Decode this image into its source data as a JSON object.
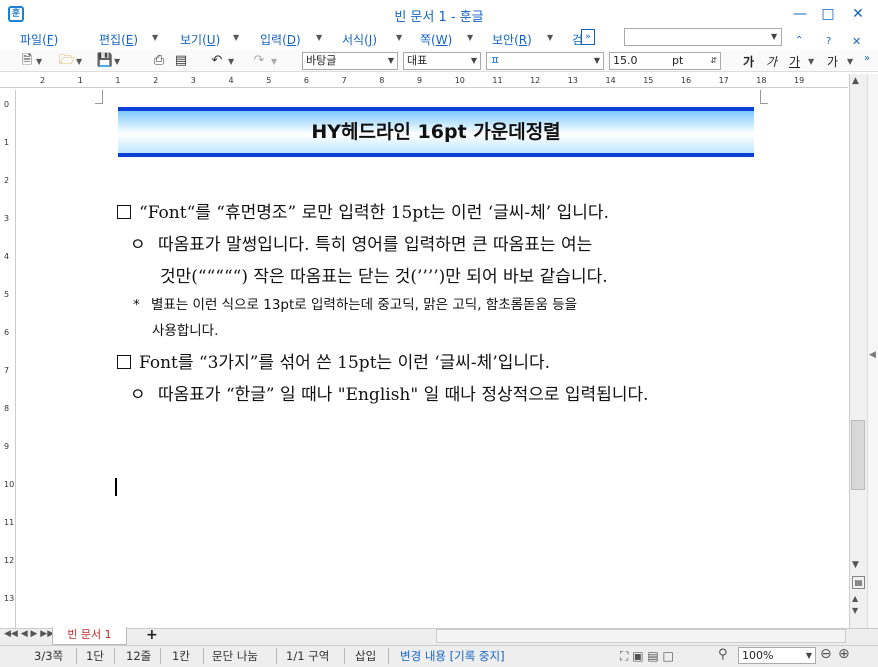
{
  "window": {
    "title": "빈 문서 1 - 훈글",
    "app_icon": "훈"
  },
  "menu": [
    {
      "label": "파일(",
      "key": "F",
      "end": ")"
    },
    {
      "label": "편집(",
      "key": "E",
      "end": ")"
    },
    {
      "label": "보기(",
      "key": "U",
      "end": ")"
    },
    {
      "label": "입력(",
      "key": "D",
      "end": ")"
    },
    {
      "label": "서식(",
      "key": "J",
      "end": ")"
    },
    {
      "label": "쪽(",
      "key": "W",
      "end": ")"
    },
    {
      "label": "보안(",
      "key": "R",
      "end": ")"
    },
    {
      "label": "검",
      "key": "",
      "end": ""
    }
  ],
  "toolbar": {
    "style": "바탕글",
    "font_lang": "대표",
    "font_name": "ㅍ",
    "font_size": "15.0",
    "font_unit": "pt",
    "bold": "가",
    "italic": "가",
    "underline": "가",
    "text_color": "가"
  },
  "ruler_h": [
    "2",
    "1",
    "1",
    "2",
    "3",
    "4",
    "5",
    "6",
    "7",
    "8",
    "9",
    "10",
    "11",
    "12",
    "13",
    "14",
    "15",
    "16",
    "17",
    "18",
    "19"
  ],
  "ruler_v": [
    "0",
    "1",
    "2",
    "3",
    "4",
    "5",
    "6",
    "7",
    "8",
    "9",
    "10",
    "11",
    "12",
    "13"
  ],
  "document": {
    "heading": "HY헤드라인 16pt 가운데정렬",
    "item1": "“Font“를 “휴먼명조” 로만 입력한 15pt는 이런 ‘글씨-체’ 입니다.",
    "item1_sub_bullet": "ㅇ",
    "item1_sub_a": "따옴표가 말썽입니다. 특히 영어를 입력하면 큰 따옴표는 여는",
    "item1_sub_b": "것만(“““““) 작은 따옴표는 닫는 것(’’’’)만 되어 바보 같습니다.",
    "note_bullet": "*",
    "note_a": "별표는 이런 식으로 13pt로 입력하는데 중고딕, 맑은 고딕, 함초롬돋움 등을",
    "note_b": "사용합니다.",
    "item2": "Font를 “3가지”를 섞어 쓴 15pt는 이런 ‘글씨-체’입니다.",
    "item2_sub_bullet": "ㅇ",
    "item2_sub": "따옴표가 “한글” 일 때나 \"English\" 일 때나 정상적으로 입력됩니다."
  },
  "tabs": {
    "active": "빈 문서 1",
    "add": "+"
  },
  "status": {
    "page": "3/3쪽",
    "column": "1단",
    "line": "12줄",
    "cell": "1칸",
    "para": "문단 나눔",
    "section": "1/1 구역",
    "mode": "삽입",
    "track": "변경 내용 [기록 중지]",
    "zoom": "100%"
  }
}
